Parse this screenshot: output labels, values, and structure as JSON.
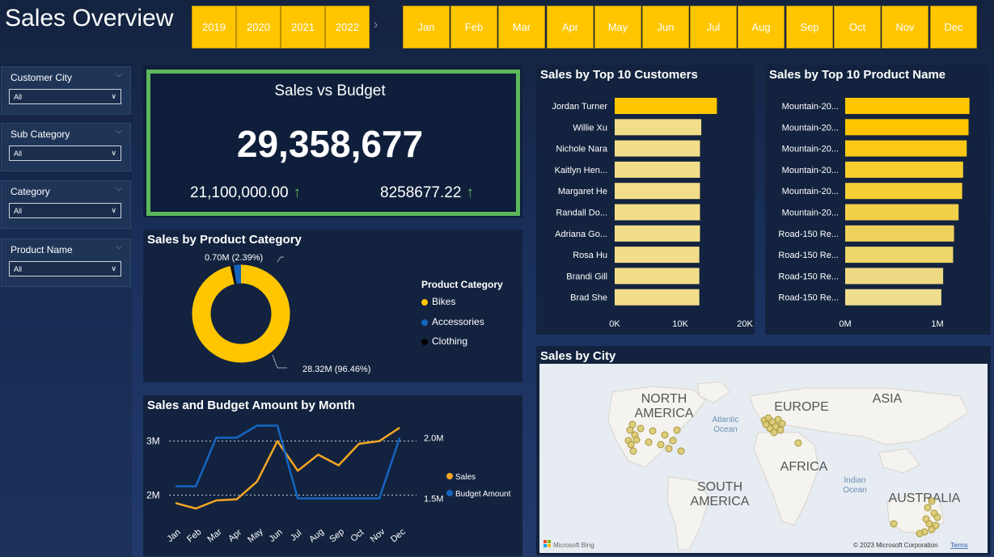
{
  "header": {
    "title": "Sales Overview"
  },
  "years": [
    "2019",
    "2020",
    "2021",
    "2022"
  ],
  "months": [
    "Jan",
    "Feb",
    "Mar",
    "Apr",
    "May",
    "Jun",
    "Jul",
    "Aug",
    "Sep",
    "Oct",
    "Nov",
    "Dec"
  ],
  "filters": [
    {
      "label": "Customer City",
      "value": "All"
    },
    {
      "label": "Sub Category",
      "value": "All"
    },
    {
      "label": "Category",
      "value": "All"
    },
    {
      "label": "Product Name",
      "value": "All"
    }
  ],
  "kpi": {
    "title": "Sales vs Budget",
    "value": "29,358,677",
    "left_value": "21,100,000.00",
    "right_value": "8258677.22",
    "accent": "#5cb85c"
  },
  "donut": {
    "title": "Sales by Product Category",
    "legend_title": "Product Category",
    "label_small": "0.70M (2.39%)",
    "label_large": "28.32M (96.46%)",
    "colors": {
      "Bikes": "#ffc600",
      "Accessories": "#1565c0",
      "Clothing": "#111111"
    }
  },
  "line_chart": {
    "title": "Sales and Budget Amount by Month",
    "left_ticks": [
      "3M",
      "2M"
    ],
    "right_ticks": [
      "2.0M",
      "1.5M"
    ],
    "legend": [
      "Sales",
      "Budget Amount"
    ]
  },
  "customers": {
    "title": "Sales by Top 10 Customers",
    "x_ticks": [
      "0K",
      "10K",
      "20K"
    ]
  },
  "products": {
    "title": "Sales by Top 10 Product Name",
    "x_ticks": [
      "0M",
      "1M"
    ]
  },
  "map": {
    "title": "Sales by City",
    "continents": [
      "NORTH\nAMERICA",
      "EUROPE",
      "ASIA",
      "AFRICA",
      "SOUTH\nAMERICA",
      "AUSTRALIA"
    ],
    "oceans": [
      "Atlantic\nOcean",
      "Indian\nOcean"
    ],
    "brand": "Microsoft Bing",
    "copyright": "© 2023 Microsoft Corporation",
    "terms": "Terms"
  },
  "chart_data": [
    {
      "type": "pie",
      "title": "Sales by Product Category",
      "categories": [
        "Bikes",
        "Accessories",
        "Clothing"
      ],
      "values": [
        96.46,
        2.39,
        1.15
      ]
    },
    {
      "type": "line",
      "title": "Sales and Budget Amount by Month",
      "x": [
        "Jan",
        "Feb",
        "Mar",
        "Apr",
        "May",
        "Jun",
        "Jul",
        "Aug",
        "Sep",
        "Oct",
        "Nov",
        "Dec"
      ],
      "series": [
        {
          "name": "Sales",
          "axis": "left",
          "values": [
            1.85,
            1.75,
            1.9,
            1.92,
            2.25,
            3.0,
            2.45,
            2.75,
            2.55,
            2.95,
            3.0,
            3.25
          ],
          "color": "#f5a623"
        },
        {
          "name": "Budget Amount",
          "axis": "right",
          "values": [
            1.6,
            1.6,
            2.0,
            2.0,
            2.1,
            2.1,
            1.5,
            1.5,
            1.5,
            1.5,
            1.5,
            2.0
          ],
          "color": "#1565c0"
        }
      ],
      "left_ylim": [
        1.6,
        3.4
      ],
      "right_ylim": [
        1.35,
        2.15
      ]
    },
    {
      "type": "bar",
      "title": "Sales by Top 10 Customers",
      "categories": [
        "Jordan Turner",
        "Willie Xu",
        "Nichole Nara",
        "Kaitlyn Hen...",
        "Margaret He",
        "Randall Do...",
        "Adriana Go...",
        "Rosa Hu",
        "Brandi Gill",
        "Brad She"
      ],
      "values": [
        15700,
        13300,
        13100,
        13100,
        13100,
        13100,
        13100,
        13000,
        13000,
        13000
      ],
      "xlim": [
        0,
        20000
      ]
    },
    {
      "type": "bar",
      "title": "Sales by Top 10 Product Name",
      "categories": [
        "Mountain-20...",
        "Mountain-20...",
        "Mountain-20...",
        "Mountain-20...",
        "Mountain-20...",
        "Mountain-20...",
        "Road-150 Re...",
        "Road-150 Re...",
        "Road-150 Re...",
        "Road-150 Re..."
      ],
      "values": [
        1.37,
        1.36,
        1.34,
        1.3,
        1.29,
        1.25,
        1.2,
        1.19,
        1.08,
        1.06
      ],
      "xlim": [
        0,
        1.4
      ]
    }
  ]
}
